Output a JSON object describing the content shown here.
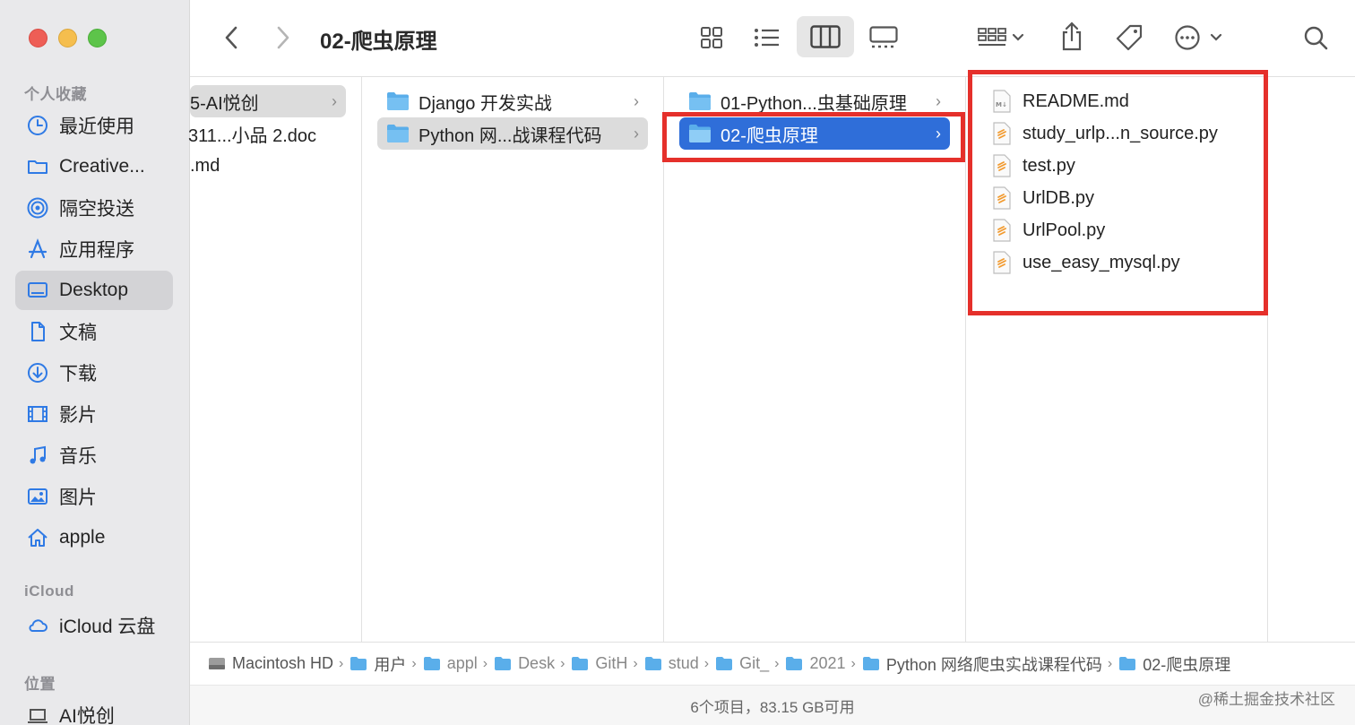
{
  "window": {
    "title": "02-爬虫原理"
  },
  "sidebar": {
    "favorites_header": "个人收藏",
    "favorites": [
      {
        "label": "最近使用",
        "icon": "clock-icon"
      },
      {
        "label": "Creative...",
        "icon": "folder-icon"
      },
      {
        "label": "隔空投送",
        "icon": "airdrop-icon"
      },
      {
        "label": "应用程序",
        "icon": "applications-icon"
      },
      {
        "label": "Desktop",
        "icon": "desktop-icon",
        "active": true
      },
      {
        "label": "文稿",
        "icon": "document-icon"
      },
      {
        "label": "下载",
        "icon": "download-icon"
      },
      {
        "label": "影片",
        "icon": "film-icon"
      },
      {
        "label": "音乐",
        "icon": "music-icon"
      },
      {
        "label": "图片",
        "icon": "photo-icon"
      },
      {
        "label": "apple",
        "icon": "home-icon"
      }
    ],
    "icloud_header": "iCloud",
    "icloud": [
      {
        "label": "iCloud 云盘",
        "icon": "cloud-icon"
      }
    ],
    "locations_header": "位置",
    "locations": [
      {
        "label": "AI悦创",
        "icon": "laptop-icon"
      }
    ]
  },
  "columns": {
    "col1": [
      "5-AI悦创",
      "311...小品 2.doc",
      ".md"
    ],
    "col2": [
      "Django 开发实战",
      "Python 网...战课程代码"
    ],
    "col3": [
      "01-Python...虫基础原理",
      "02-爬虫原理"
    ],
    "col4": [
      "README.md",
      "study_urlp...n_source.py",
      "test.py",
      "UrlDB.py",
      "UrlPool.py",
      "use_easy_mysql.py"
    ]
  },
  "pathbar": [
    "Macintosh HD",
    "用户",
    "appl",
    "Desk",
    "GitH",
    "stud",
    "Git_",
    "2021",
    "Python 网络爬虫实战课程代码",
    "02-爬虫原理"
  ],
  "status": "6个项目，83.15 GB可用",
  "watermark": "@稀土掘金技术社区",
  "colors": {
    "selection": "#2f6ed9",
    "highlight_box": "#e5302b",
    "folder": "#5aaeea"
  }
}
